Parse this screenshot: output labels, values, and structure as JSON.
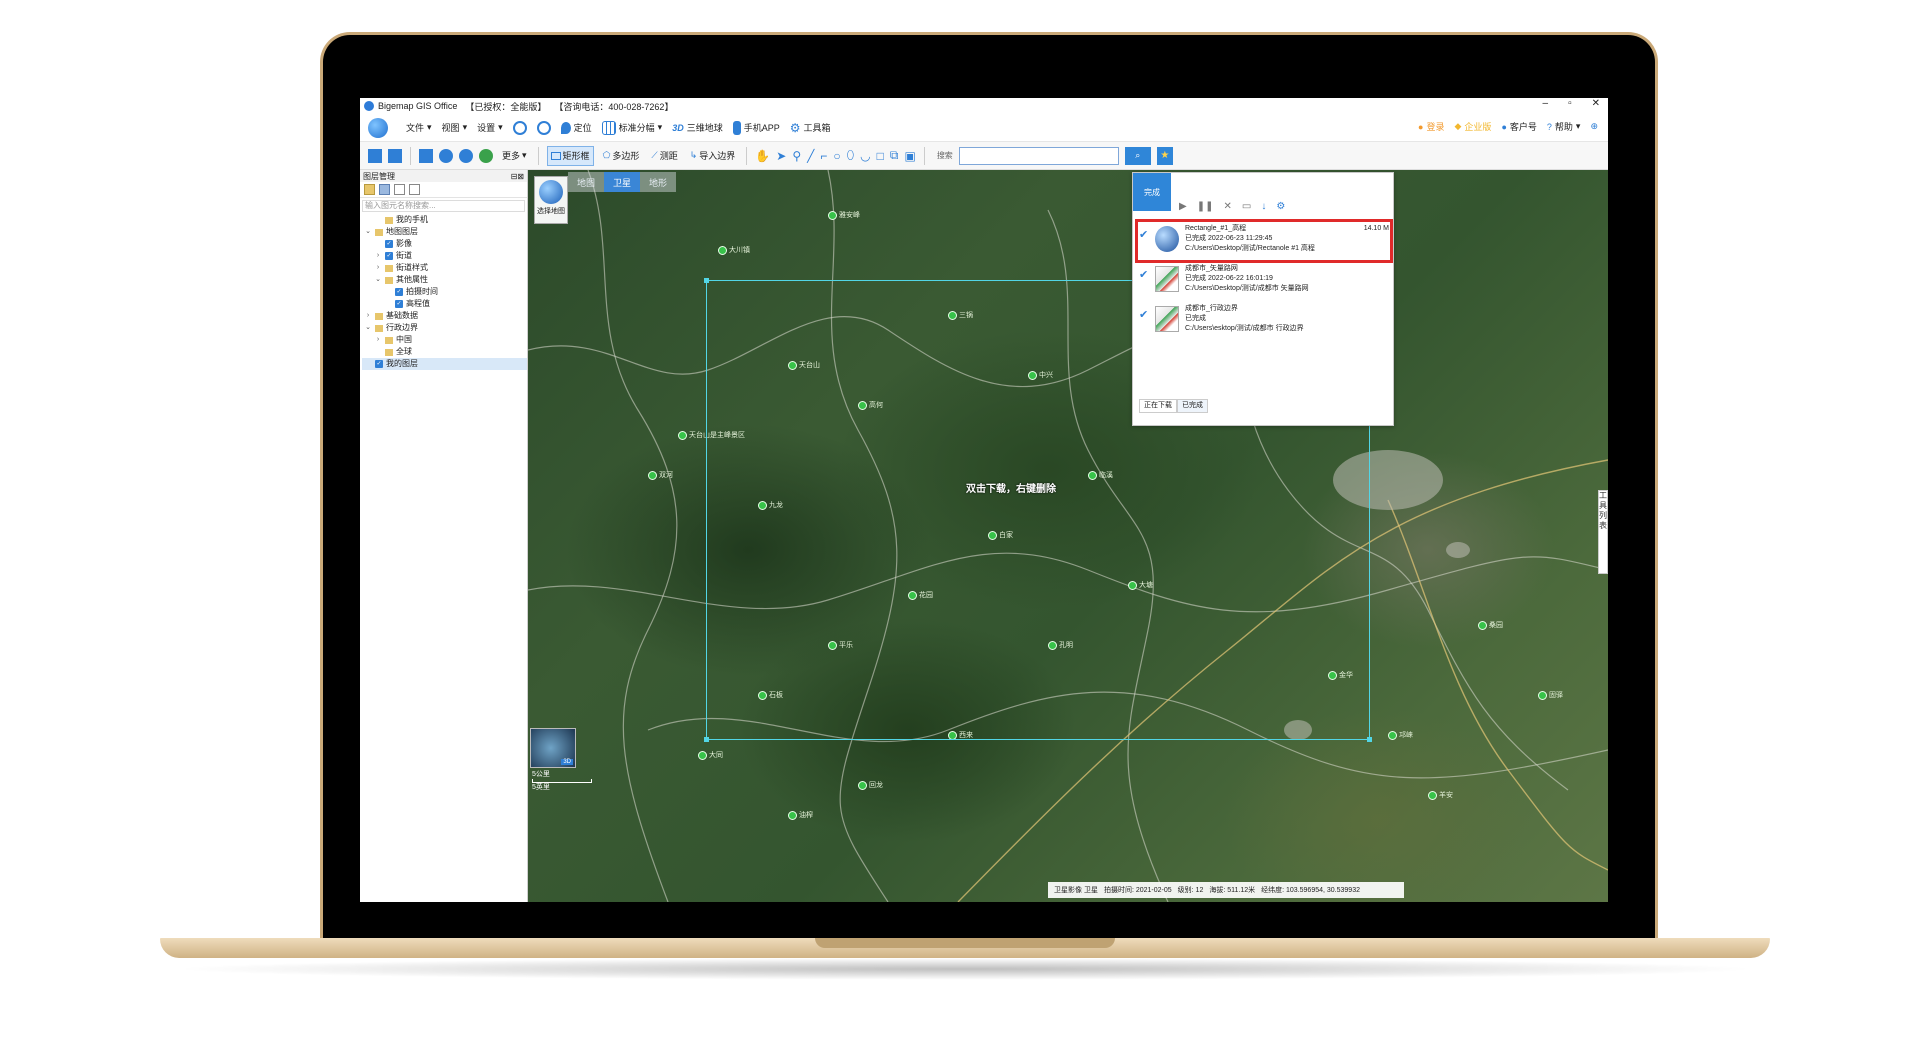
{
  "window": {
    "title": "Bigemap GIS Office",
    "license": "【已授权：全能版】",
    "hotline": "【咨询电话：400-028-7262】",
    "controls": [
      "–",
      "▫",
      "✕"
    ]
  },
  "menu": {
    "items": [
      "文件",
      "视图",
      "设置"
    ],
    "tools": [
      "定位",
      "标准分幅",
      "三维地球",
      "手机APP",
      "工具箱"
    ],
    "right": [
      "登录",
      "企业版",
      "客户号",
      "帮助"
    ]
  },
  "toolbar": {
    "more": "更多",
    "buttons": [
      "矩形框",
      "多边形",
      "测距",
      "导入边界"
    ],
    "search_label": "搜索",
    "search_value": ""
  },
  "layers": {
    "title": "图层管理",
    "search_placeholder": "输入图元名称搜索...",
    "items": [
      {
        "label": "我的手机",
        "level": 1,
        "checked": false,
        "arrow": ""
      },
      {
        "label": "地图图层",
        "level": 0,
        "checked": false,
        "arrow": "v"
      },
      {
        "label": "影像",
        "level": 1,
        "checked": true,
        "arrow": ""
      },
      {
        "label": "街道",
        "level": 1,
        "checked": true,
        "arrow": ">"
      },
      {
        "label": "街道样式",
        "level": 1,
        "checked": false,
        "arrow": ">"
      },
      {
        "label": "其他属性",
        "level": 1,
        "checked": false,
        "arrow": "v"
      },
      {
        "label": "拍摄时间",
        "level": 2,
        "checked": true,
        "arrow": ""
      },
      {
        "label": "高程值",
        "level": 2,
        "checked": true,
        "arrow": ""
      },
      {
        "label": "基础数据",
        "level": 0,
        "checked": false,
        "arrow": ">"
      },
      {
        "label": "行政边界",
        "level": 0,
        "checked": false,
        "arrow": "v"
      },
      {
        "label": "中国",
        "level": 1,
        "checked": false,
        "arrow": ">"
      },
      {
        "label": "全球",
        "level": 1,
        "checked": false,
        "arrow": ""
      },
      {
        "label": "我的图层",
        "level": 0,
        "checked": true,
        "arrow": ""
      }
    ]
  },
  "map": {
    "tabs": [
      "地图",
      "卫星",
      "地形"
    ],
    "active_tab": "卫星",
    "select_map": "选择地图",
    "hint": "双击下载，右键删除",
    "minimap_tag": "3D",
    "scale_km": "5公里",
    "scale_mi": "5英里",
    "side_tab": "工具列表",
    "status": {
      "layer": "卫星影像 卫星",
      "time": "拍摄时间: 2021-02-05",
      "level": "级别: 12",
      "elevation": "海拔: 511.12米",
      "coords": "经纬度: 103.596954, 30.539932"
    }
  },
  "download_panel": {
    "done_label": "完成",
    "tabs": [
      "正在下载",
      "已完成"
    ],
    "items": [
      {
        "name": "Rectangle_#1_高程",
        "status": "已完成 2022-06-23 11:29:45",
        "path": "C:/Users\\Desktop/测试/Rectanole #1 高程",
        "size": "14.10 M",
        "thumb": "globe",
        "highlight": true
      },
      {
        "name": "成都市_矢量路网",
        "status": "已完成 2022-06-22 16:01:19",
        "path": "C:/Users\\Desktop/测试/成都市 矢量路网",
        "size": "",
        "thumb": "sheet",
        "highlight": false
      },
      {
        "name": "成都市_行政边界",
        "status": "已完成",
        "path": "C:/Users\\esktop/测试/成都市 行政边界",
        "size": "",
        "thumb": "sheet",
        "highlight": false
      }
    ]
  },
  "poi_labels": [
    "大川镇",
    "雅安峰",
    "天台山",
    "天台山是主峰景区",
    "双河",
    "九龙",
    "高何",
    "三锅",
    "中兴",
    "临溪",
    "白家",
    "花园",
    "平乐",
    "石板",
    "大同",
    "油榨",
    "回龙",
    "西来",
    "孔明",
    "大塘",
    "天台山镇",
    "高山",
    "宝林",
    "甘溪",
    "金华",
    "邛崃",
    "羊安",
    "桑园",
    "固驿"
  ]
}
